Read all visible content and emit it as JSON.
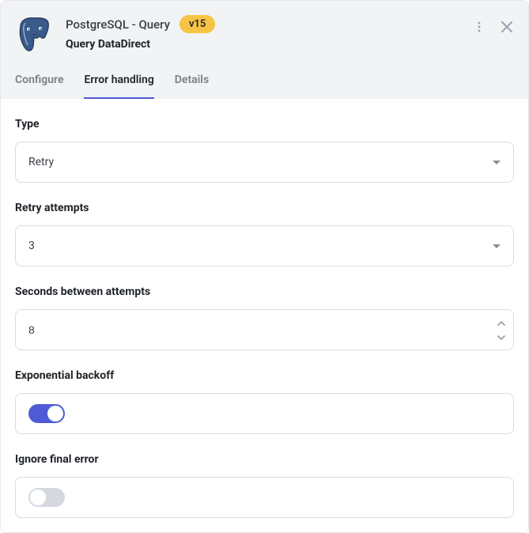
{
  "header": {
    "title": "PostgreSQL - Query",
    "badge": "v15",
    "subtitle": "Query DataDirect"
  },
  "tabs": {
    "configure": "Configure",
    "error_handling": "Error handling",
    "details": "Details"
  },
  "fields": {
    "type": {
      "label": "Type",
      "value": "Retry"
    },
    "retry_attempts": {
      "label": "Retry attempts",
      "value": "3"
    },
    "seconds_between": {
      "label": "Seconds between attempts",
      "value": "8"
    },
    "exponential_backoff": {
      "label": "Exponential backoff",
      "value": true
    },
    "ignore_final_error": {
      "label": "Ignore final error",
      "value": false
    }
  }
}
